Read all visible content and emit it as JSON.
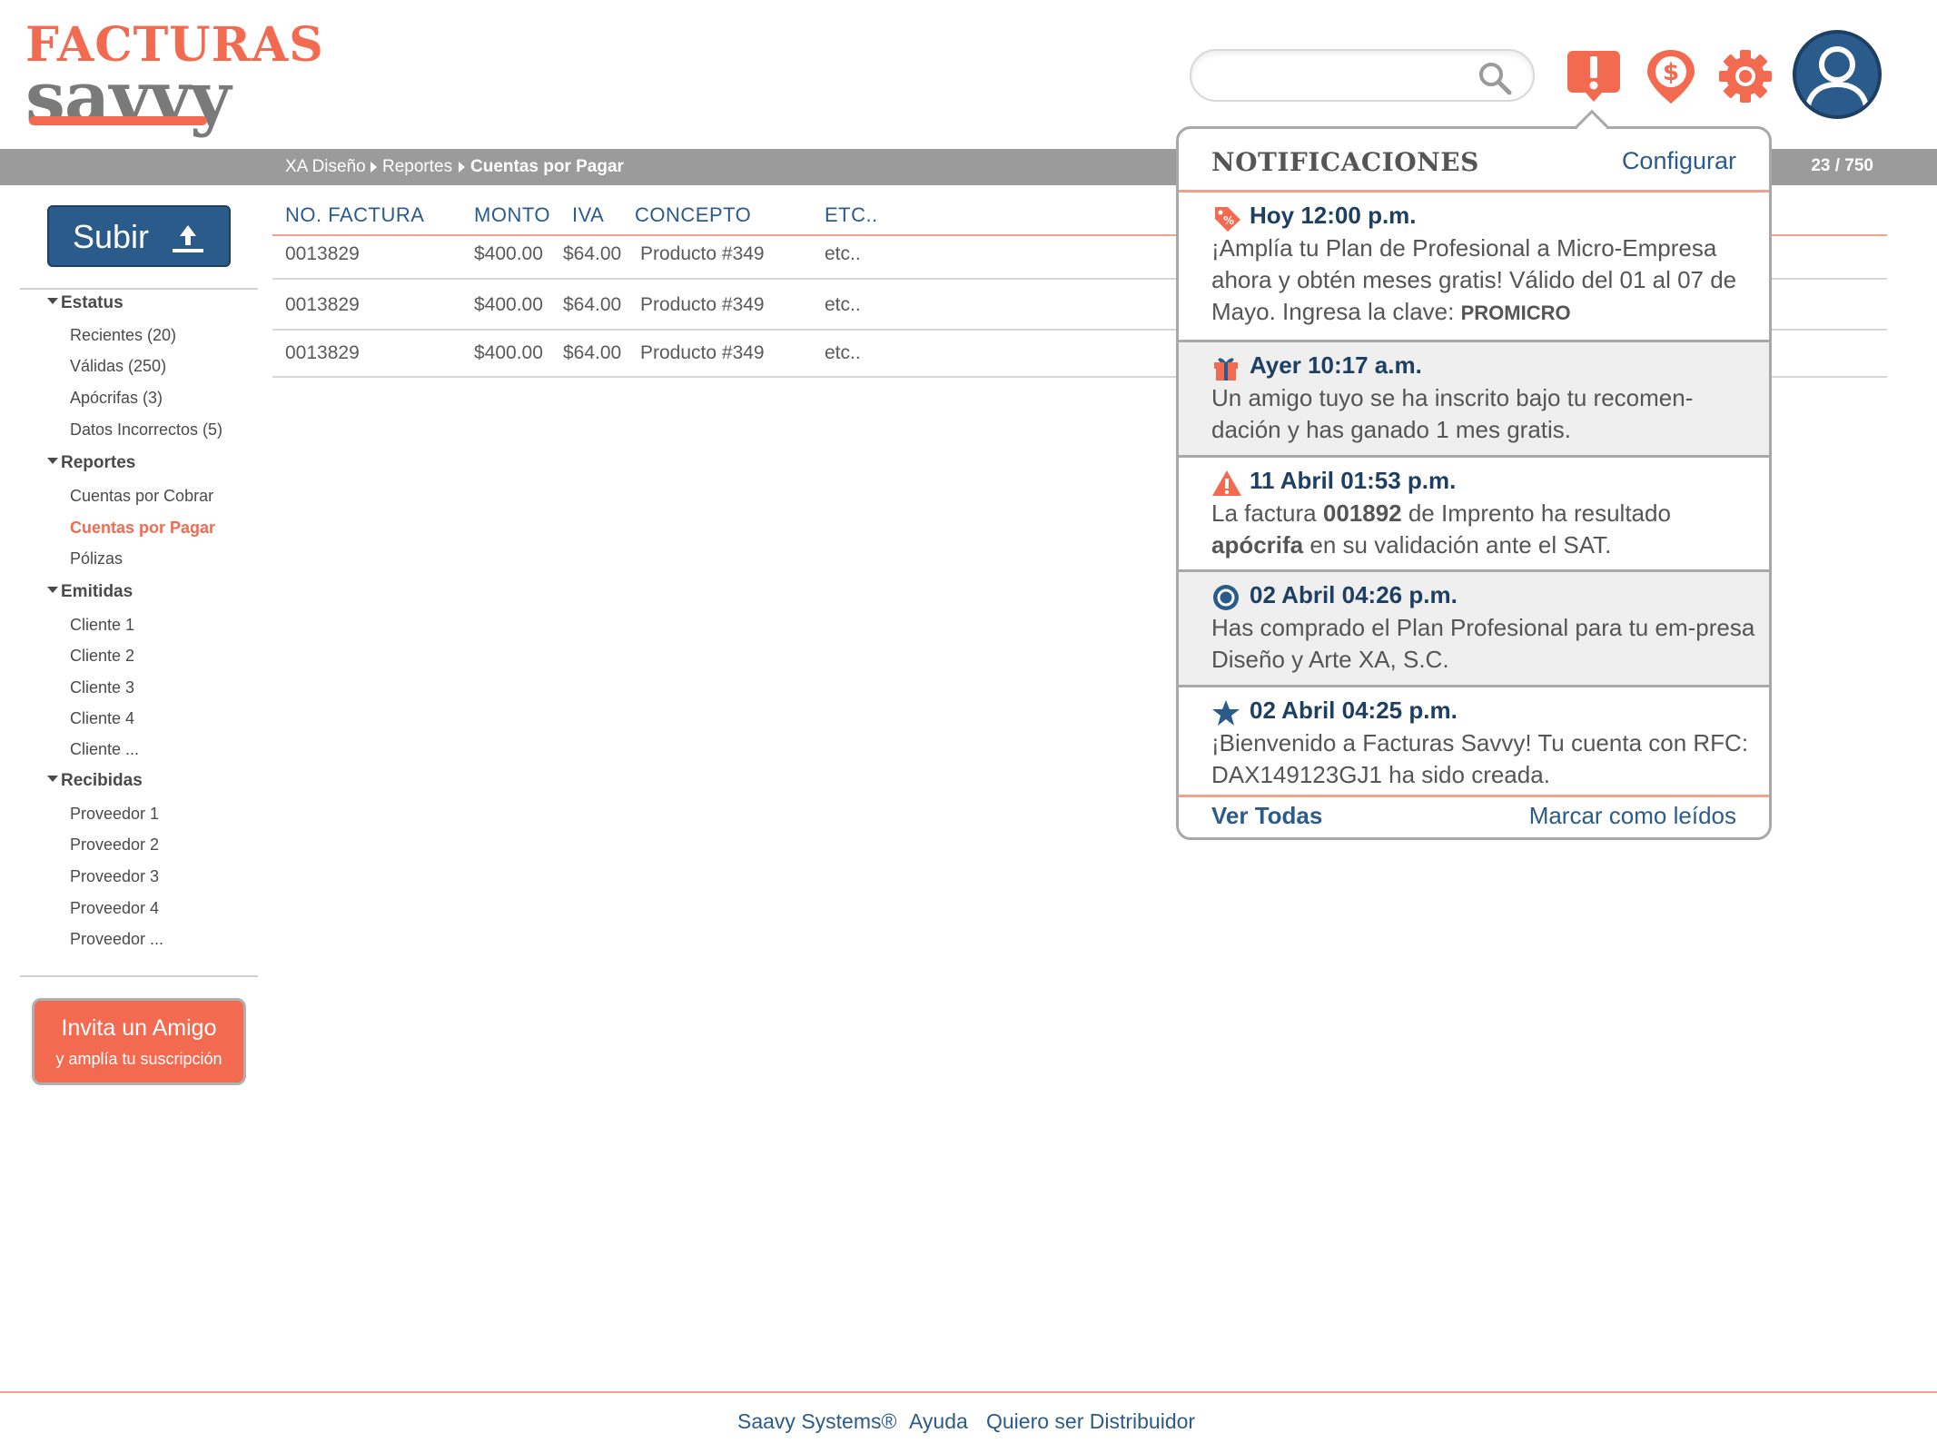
{
  "logo": {
    "top": "FACTURAS",
    "bottom": "savvy"
  },
  "header": {
    "search": {
      "value": "",
      "placeholder": ""
    },
    "icons": [
      "alert-icon",
      "dollar-pin-icon",
      "gear-icon",
      "user-avatar-icon"
    ]
  },
  "breadcrumb": {
    "items": [
      "XA Diseño",
      "Reportes",
      "Cuentas por Pagar"
    ],
    "page_count": "23 / 750"
  },
  "sidebar": {
    "upload_label": "Subir",
    "sections": [
      {
        "label": "Estatus",
        "items": [
          "Recientes (20)",
          "Válidas (250)",
          "Apócrifas (3)",
          "Datos Incorrectos (5)"
        ]
      },
      {
        "label": "Reportes",
        "items": [
          "Cuentas por Cobrar",
          "Cuentas por Pagar",
          "Pólizas"
        ]
      },
      {
        "label": "Emitidas",
        "items": [
          "Cliente 1",
          "Cliente 2",
          "Cliente 3",
          "Cliente 4",
          "Cliente ..."
        ]
      },
      {
        "label": "Recibidas",
        "items": [
          "Proveedor 1",
          "Proveedor 2",
          "Proveedor 3",
          "Proveedor 4",
          "Proveedor ..."
        ]
      }
    ],
    "active_item": "Cuentas por Pagar",
    "invite": {
      "title": "Invita un Amigo",
      "subtitle": "y amplía tu suscripción"
    }
  },
  "table": {
    "columns": [
      "NO. FACTURA",
      "MONTO",
      "IVA",
      "CONCEPTO",
      "ETC.."
    ],
    "rows": [
      [
        "0013829",
        "$400.00",
        "$64.00",
        "Producto #349",
        "etc.."
      ],
      [
        "0013829",
        "$400.00",
        "$64.00",
        "Producto #349",
        "etc.."
      ],
      [
        "0013829",
        "$400.00",
        "$64.00",
        "Producto #349",
        "etc.."
      ]
    ]
  },
  "notifications": {
    "title": "NOTIFICACIONES",
    "config_label": "Configurar",
    "items": [
      {
        "icon": "discount-tag-icon",
        "time": "Hoy 12:00 p.m.",
        "text_1": "¡Amplía tu Plan de Profesional a Micro-Empresa ahora y obtén meses gratis! Válido del 01 al 07 de Mayo. Ingresa la clave: ",
        "code": "PROMICRO"
      },
      {
        "icon": "gift-icon",
        "time": "Ayer 10:17 a.m.",
        "text_1": "Un amigo tuyo se ha inscrito bajo tu recomen-dación y has ganado 1 mes gratis."
      },
      {
        "icon": "warning-icon",
        "time": "11 Abril 01:53 p.m.",
        "text_1": "La factura ",
        "bold_1": "001892",
        "text_2": " de Imprento ha resultado ",
        "bold_2": "apócrifa",
        "text_3": " en su validación ante el SAT."
      },
      {
        "icon": "circle-badge-icon",
        "time": "02 Abril 04:26 p.m.",
        "text_1": "Has comprado el Plan Profesional para tu em-presa Diseño y Arte XA, S.C."
      },
      {
        "icon": "star-icon",
        "time": "02 Abril 04:25 p.m.",
        "text_1": "¡Bienvenido a Facturas Savvy! Tu cuenta con RFC: DAX149123GJ1 ha sido creada."
      }
    ],
    "view_all": "Ver Todas",
    "mark_read": "Marcar como leídos"
  },
  "footer": {
    "links": [
      "Saavy Systems®",
      "Ayuda",
      "Quiero ser Distribuidor"
    ]
  },
  "colors": {
    "accent": "#f26b50",
    "primary": "#2b5b8a",
    "bar": "#9b9b9b"
  }
}
